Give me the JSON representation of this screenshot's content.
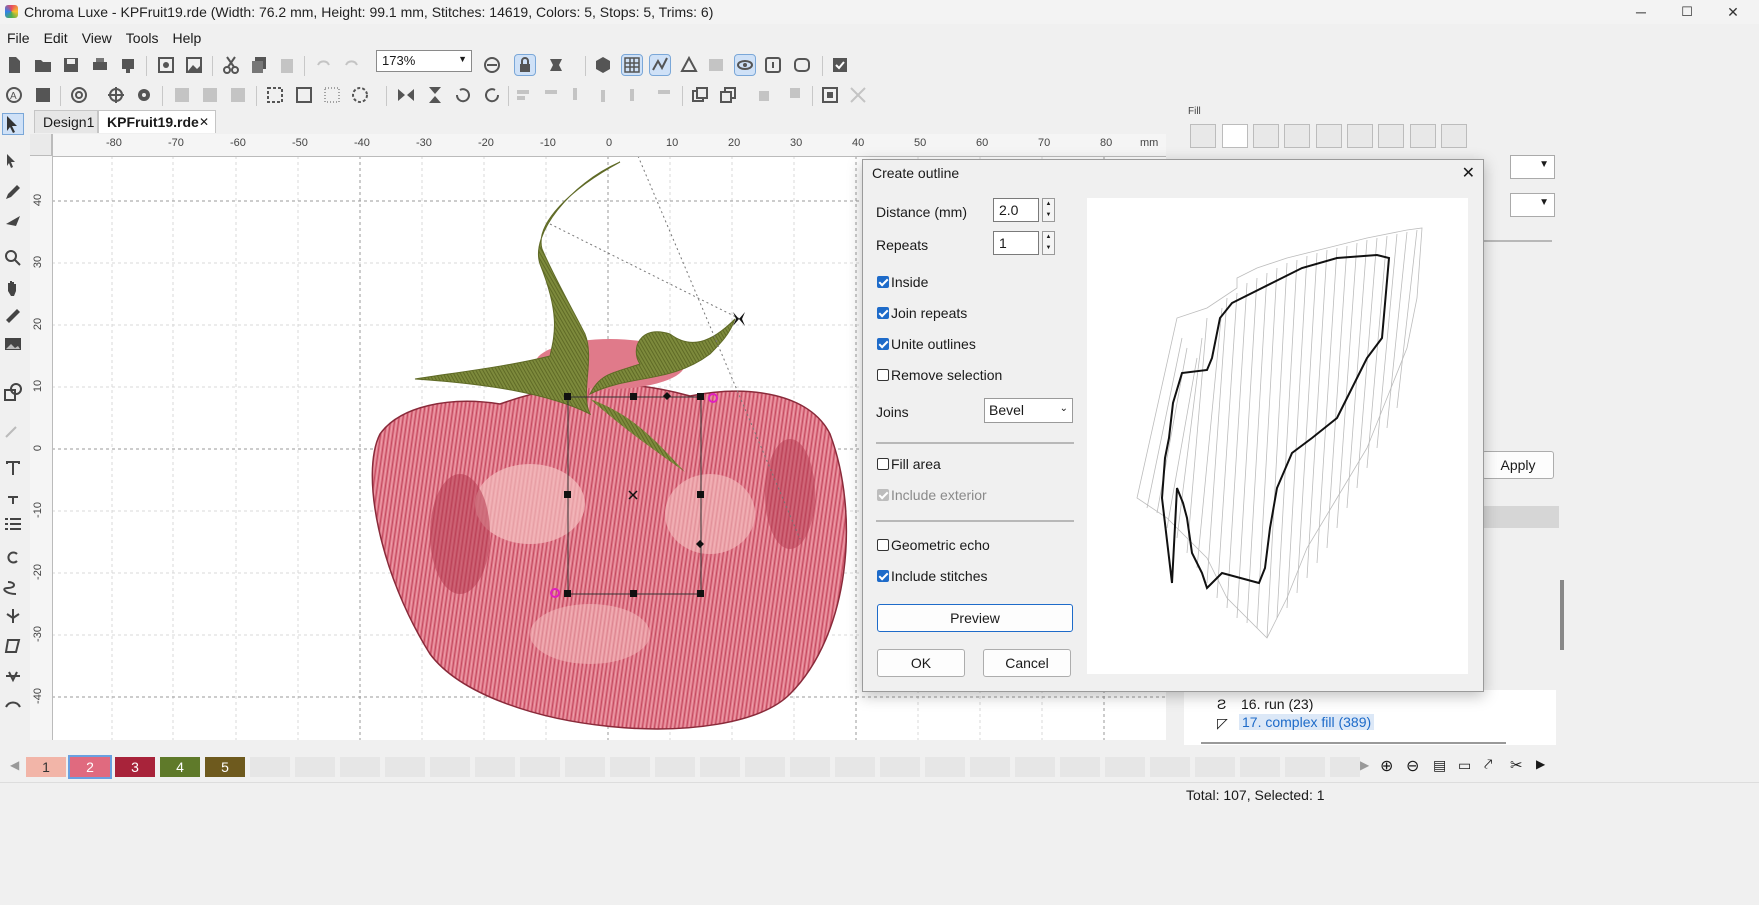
{
  "window": {
    "title": "Chroma Luxe - KPFruit19.rde (Width: 76.2 mm, Height: 99.1 mm, Stitches: 14619, Colors: 5, Stops: 5, Trims: 6)",
    "minimize": "─",
    "maximize": "☐",
    "close": "✕"
  },
  "menu": {
    "file": "File",
    "edit": "Edit",
    "view": "View",
    "tools": "Tools",
    "help": "Help"
  },
  "toolbar": {
    "zoom_value": "173%"
  },
  "tabs": {
    "design1": "Design1",
    "active": "KPFruit19.rde",
    "active_close": "✕"
  },
  "ruler": {
    "unit": "mm",
    "h_ticks": [
      "-80",
      "-70",
      "-60",
      "-50",
      "-40",
      "-30",
      "-20",
      "-10",
      "0",
      "10",
      "20",
      "30",
      "40",
      "50",
      "60",
      "70",
      "80"
    ],
    "v_ticks": [
      "40",
      "30",
      "20",
      "10",
      "0",
      "-10",
      "-20",
      "-30",
      "-40"
    ]
  },
  "right_panel": {
    "section_label": "Fill",
    "apply_label": "Apply",
    "tree_items": [
      {
        "label": "16. run (23)",
        "selected": false
      },
      {
        "label": "17. complex fill (389)",
        "selected": true
      }
    ]
  },
  "dialog": {
    "title": "Create outline",
    "close": "✕",
    "distance_label": "Distance (mm)",
    "distance_value": "2.0",
    "repeats_label": "Repeats",
    "repeats_value": "1",
    "inside_label": "Inside",
    "join_repeats_label": "Join repeats",
    "unite_outlines_label": "Unite outlines",
    "remove_selection_label": "Remove selection",
    "joins_label": "Joins",
    "joins_value": "Bevel",
    "fill_area_label": "Fill area",
    "include_exterior_label": "Include exterior",
    "geometric_echo_label": "Geometric echo",
    "include_stitches_label": "Include stitches",
    "preview_label": "Preview",
    "ok_label": "OK",
    "cancel_label": "Cancel",
    "checks": {
      "inside": true,
      "join_repeats": true,
      "unite_outlines": true,
      "remove_selection": false,
      "fill_area": false,
      "include_exterior": true,
      "geometric_echo": false,
      "include_stitches": true
    }
  },
  "colors": {
    "swatches": [
      {
        "label": "1",
        "color": "#f2b5a8",
        "text": "#333333"
      },
      {
        "label": "2",
        "color": "#e06a7f",
        "text": "#ffffff"
      },
      {
        "label": "3",
        "color": "#a8233a",
        "text": "#ffffff"
      },
      {
        "label": "4",
        "color": "#5f7a2a",
        "text": "#ffffff"
      },
      {
        "label": "5",
        "color": "#6e5a1e",
        "text": "#ffffff"
      }
    ],
    "accent": "#1e6bc9"
  },
  "status": {
    "text": "Total: 107, Selected: 1"
  }
}
